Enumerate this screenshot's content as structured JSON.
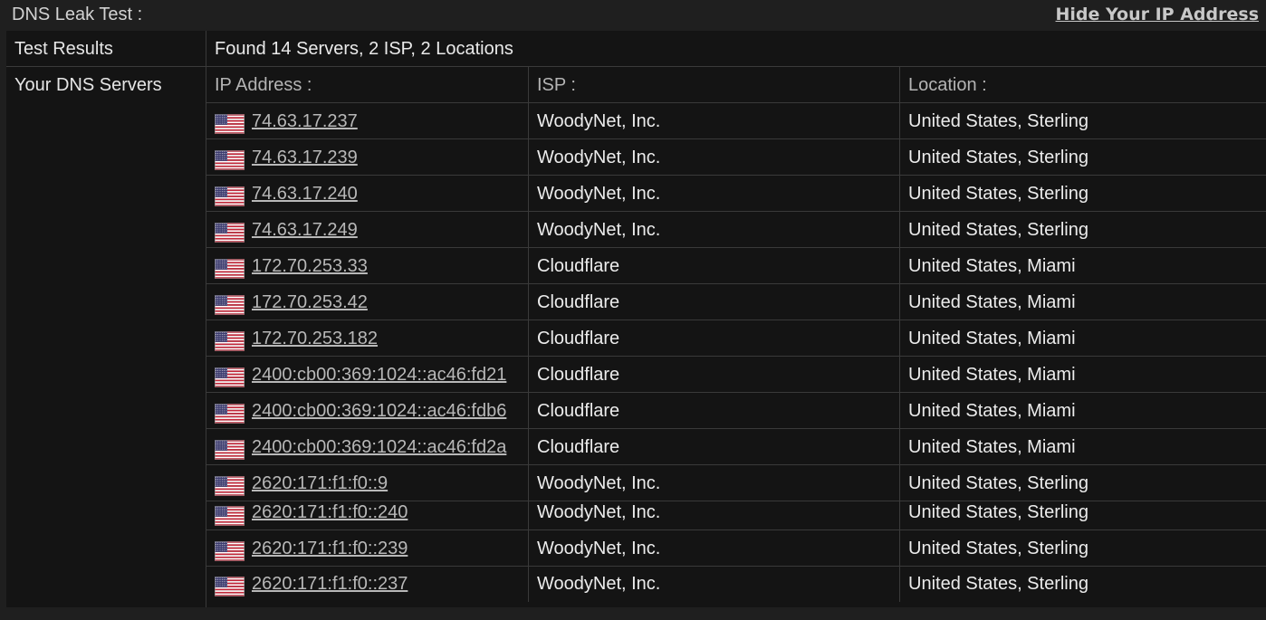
{
  "header": {
    "title": "DNS Leak Test :",
    "hide_link": "Hide Your IP Address"
  },
  "results": {
    "label": "Test Results",
    "value": "Found 14 Servers, 2 ISP, 2 Locations"
  },
  "dns": {
    "label": "Your DNS Servers",
    "columns": {
      "ip": "IP Address :",
      "isp": "ISP :",
      "location": "Location :"
    },
    "flag_icon": "us-flag-icon",
    "rows": [
      {
        "ip": "74.63.17.237",
        "isp": "WoodyNet, Inc.",
        "location": "United States, Sterling"
      },
      {
        "ip": "74.63.17.239",
        "isp": "WoodyNet, Inc.",
        "location": "United States, Sterling"
      },
      {
        "ip": "74.63.17.240",
        "isp": "WoodyNet, Inc.",
        "location": "United States, Sterling"
      },
      {
        "ip": "74.63.17.249",
        "isp": "WoodyNet, Inc.",
        "location": "United States, Sterling"
      },
      {
        "ip": "172.70.253.33",
        "isp": "Cloudflare",
        "location": "United States, Miami"
      },
      {
        "ip": "172.70.253.42",
        "isp": "Cloudflare",
        "location": "United States, Miami"
      },
      {
        "ip": "172.70.253.182",
        "isp": "Cloudflare",
        "location": "United States, Miami"
      },
      {
        "ip": "2400:cb00:369:1024::ac46:fd21",
        "isp": "Cloudflare",
        "location": "United States, Miami"
      },
      {
        "ip": "2400:cb00:369:1024::ac46:fdb6",
        "isp": "Cloudflare",
        "location": "United States, Miami"
      },
      {
        "ip": "2400:cb00:369:1024::ac46:fd2a",
        "isp": "Cloudflare",
        "location": "United States, Miami"
      },
      {
        "ip": "2620:171:f1:f0::9",
        "isp": "WoodyNet, Inc.",
        "location": "United States, Sterling"
      },
      {
        "ip": "2620:171:f1:f0::240",
        "isp": "WoodyNet, Inc.",
        "location": "United States, Sterling"
      },
      {
        "ip": "2620:171:f1:f0::239",
        "isp": "WoodyNet, Inc.",
        "location": "United States, Sterling"
      },
      {
        "ip": "2620:171:f1:f0::237",
        "isp": "WoodyNet, Inc.",
        "location": "United States, Sterling"
      }
    ]
  }
}
